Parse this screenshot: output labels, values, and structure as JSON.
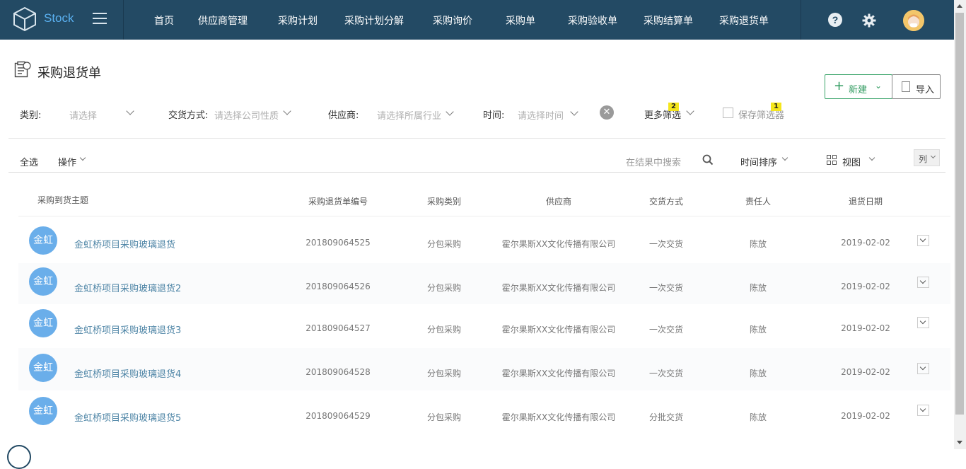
{
  "brand": {
    "name": "Stock"
  },
  "nav": {
    "items": [
      {
        "label": "首页"
      },
      {
        "label": "供应商管理"
      },
      {
        "label": "采购计划"
      },
      {
        "label": "采购计划分解"
      },
      {
        "label": "采购询价"
      },
      {
        "label": "采购单"
      },
      {
        "label": "采购验收单"
      },
      {
        "label": "采购结算单"
      },
      {
        "label": "采购退货单"
      }
    ],
    "help_glyph": "?"
  },
  "page": {
    "title": "采购退货单",
    "new_button": "新建",
    "import_button": "导入"
  },
  "filters": {
    "category_label": "类别:",
    "category_placeholder": "请选择",
    "delivery_label": "交货方式:",
    "delivery_placeholder": "请选择公司性质",
    "supplier_label": "供应商:",
    "supplier_placeholder": "请选择所属行业",
    "time_label": "时间:",
    "time_placeholder": "请选择时间",
    "more_filters": "更多筛选",
    "more_filters_badge": "2",
    "save_filter": "保存筛选器",
    "save_filter_badge": "1"
  },
  "toolbar": {
    "select_all": "全选",
    "actions": "操作",
    "search_placeholder": "在结果中搜索",
    "sort": "时间排序",
    "view": "视图",
    "columns": "列"
  },
  "table": {
    "headers": {
      "subject": "采购到货主题",
      "number": "采购退货单编号",
      "type": "采购类别",
      "supplier": "供应商",
      "delivery": "交货方式",
      "owner": "责任人",
      "date": "退货日期"
    },
    "rows": [
      {
        "avatar": "金虹",
        "subject": "金虹桥项目采购玻璃退货",
        "number": "201809064525",
        "type": "分包采购",
        "supplier": "霍尔果斯XX文化传播有限公司",
        "delivery": "一次交货",
        "owner": "陈放",
        "date": "2019-02-02"
      },
      {
        "avatar": "金虹",
        "subject": "金虹桥项目采购玻璃退货2",
        "number": "201809064526",
        "type": "分包采购",
        "supplier": "霍尔果斯XX文化传播有限公司",
        "delivery": "一次交货",
        "owner": "陈放",
        "date": "2019-02-02"
      },
      {
        "avatar": "金虹",
        "subject": "金虹桥项目采购玻璃退货3",
        "number": "201809064527",
        "type": "分包采购",
        "supplier": "霍尔果斯XX文化传播有限公司",
        "delivery": "一次交货",
        "owner": "陈放",
        "date": "2019-02-02"
      },
      {
        "avatar": "金虹",
        "subject": "金虹桥项目采购玻璃退货4",
        "number": "201809064528",
        "type": "分包采购",
        "supplier": "霍尔果斯XX文化传播有限公司",
        "delivery": "一次交货",
        "owner": "陈放",
        "date": "2019-02-02"
      },
      {
        "avatar": "金虹",
        "subject": "金虹桥项目采购玻璃退货5",
        "number": "201809064529",
        "type": "分包采购",
        "supplier": "霍尔果斯XX文化传播有限公司",
        "delivery": "分批交货",
        "owner": "陈放",
        "date": "2019-02-02"
      }
    ]
  },
  "colors": {
    "topbar": "#234a64",
    "brand_text": "#5ab0f0",
    "accent_green": "#2e9a5e",
    "link_blue": "#4e85a6",
    "avatar_blue": "#6aaeea",
    "badge_yellow": "#f5e61c"
  }
}
